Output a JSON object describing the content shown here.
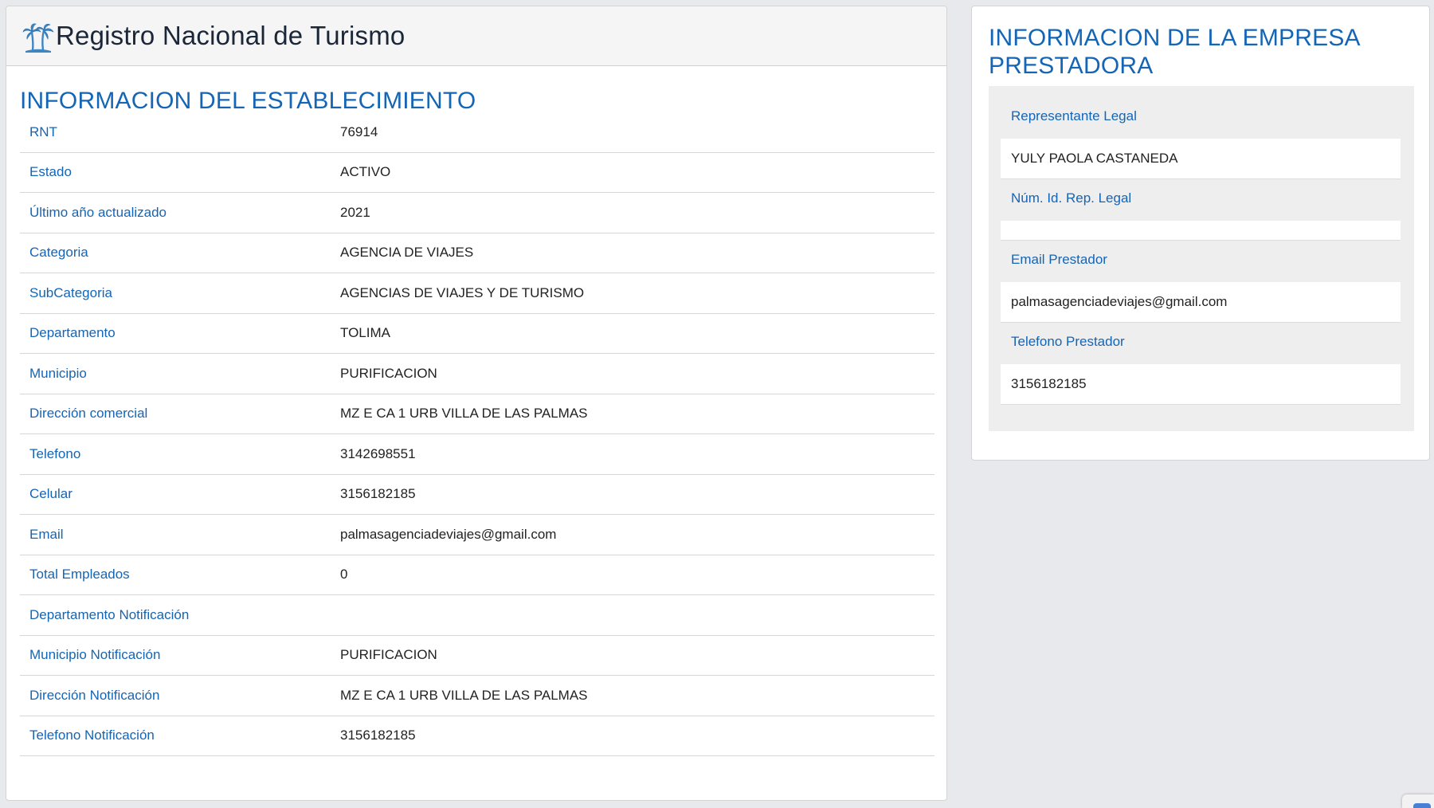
{
  "header": {
    "app_title": "Registro Nacional de Turismo",
    "logo_icon": "palm-trees-icon"
  },
  "establecimiento": {
    "title": "INFORMACION DEL ESTABLECIMIENTO",
    "rows": [
      {
        "label": "RNT",
        "value": "76914"
      },
      {
        "label": "Estado",
        "value": "ACTIVO"
      },
      {
        "label": "Último año actualizado",
        "value": "2021"
      },
      {
        "label": "Categoria",
        "value": "AGENCIA DE VIAJES"
      },
      {
        "label": "SubCategoria",
        "value": "AGENCIAS DE VIAJES Y DE TURISMO"
      },
      {
        "label": "Departamento",
        "value": "TOLIMA"
      },
      {
        "label": "Municipio",
        "value": "PURIFICACION"
      },
      {
        "label": "Dirección comercial",
        "value": "MZ E CA 1 URB VILLA DE LAS PALMAS"
      },
      {
        "label": "Telefono",
        "value": "3142698551"
      },
      {
        "label": "Celular",
        "value": "3156182185"
      },
      {
        "label": "Email",
        "value": "palmasagenciadeviajes@gmail.com"
      },
      {
        "label": "Total Empleados",
        "value": "0"
      },
      {
        "label": "Departamento Notificación",
        "value": ""
      },
      {
        "label": "Municipio Notificación",
        "value": "PURIFICACION"
      },
      {
        "label": "Dirección Notificación",
        "value": "MZ E CA 1 URB VILLA DE LAS PALMAS"
      },
      {
        "label": "Telefono Notificación",
        "value": "3156182185"
      }
    ]
  },
  "empresa": {
    "title": "INFORMACION DE LA EMPRESA PRESTADORA",
    "representante_label": "Representante Legal",
    "representante_value": "YULY PAOLA CASTANEDA",
    "id_label": "Núm. Id. Rep. Legal",
    "id_value": "",
    "email_label": "Email Prestador",
    "email_value": "palmasagenciadeviajes@gmail.com",
    "telefono_label": "Telefono Prestador",
    "telefono_value": "3156182185"
  },
  "colors": {
    "accent": "#1565b5",
    "background": "#e8e9ec",
    "panel_header": "#f5f5f5",
    "field_group": "#eeeeee"
  }
}
